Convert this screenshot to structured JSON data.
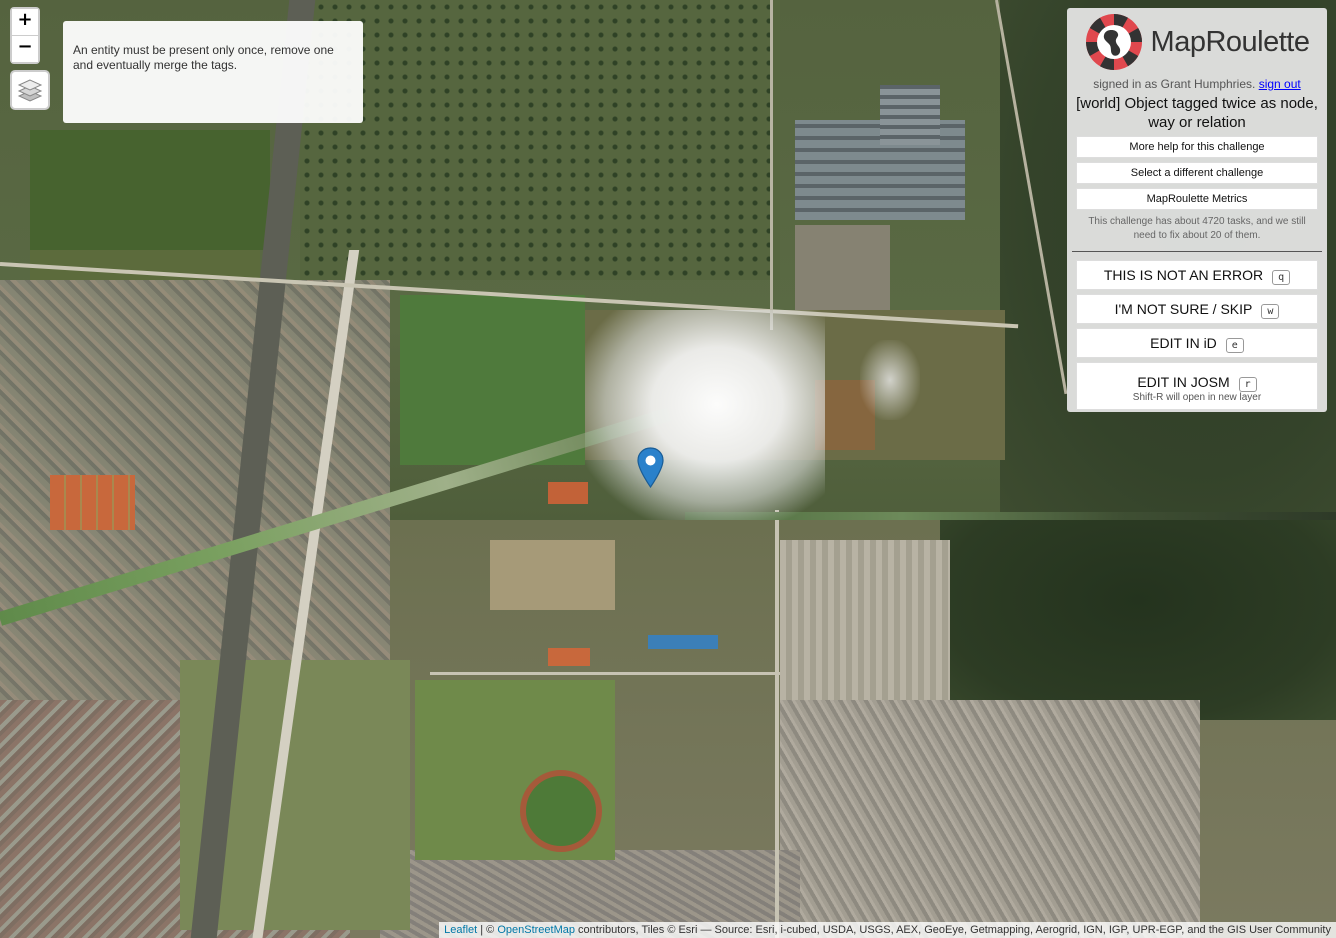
{
  "zoom": {
    "in_label": "+",
    "out_label": "−"
  },
  "instructions": "An entity must be present only once, remove one and eventually merge the tags.",
  "panel": {
    "brand": "MapRoulette",
    "signed_in_prefix": "signed in as Grant Humphries.",
    "sign_out": "sign out",
    "challenge_title": "[world] Object tagged twice as node, way or relation",
    "help_button": "More help for this challenge",
    "select_button": "Select a different challenge",
    "metrics_button": "MapRoulette Metrics",
    "stats": "This challenge has about 4720 tasks, and we still need to fix about 20 of them.",
    "actions": [
      {
        "label": "THIS IS NOT AN ERROR",
        "key": "q"
      },
      {
        "label": "I'M NOT SURE / SKIP",
        "key": "w"
      },
      {
        "label": "EDIT IN iD",
        "key": "e"
      },
      {
        "label": "EDIT IN JOSM",
        "key": "r"
      }
    ],
    "josm_hint": "Shift-R will open in new layer"
  },
  "attribution": {
    "leaflet": "Leaflet",
    "sep": " | © ",
    "osm": "OpenStreetMap",
    "rest": " contributors, Tiles © Esri — Source: Esri, i-cubed, USDA, USGS, AEX, GeoEye, Getmapping, Aerogrid, IGN, IGP, UPR-EGP, and the GIS User Community"
  },
  "colors": {
    "marker": "#2a81cb",
    "link": "#0078a8"
  },
  "icons": {
    "layers": "layers-icon",
    "marker": "map-marker-icon",
    "logo": "globe-roulette-logo"
  }
}
